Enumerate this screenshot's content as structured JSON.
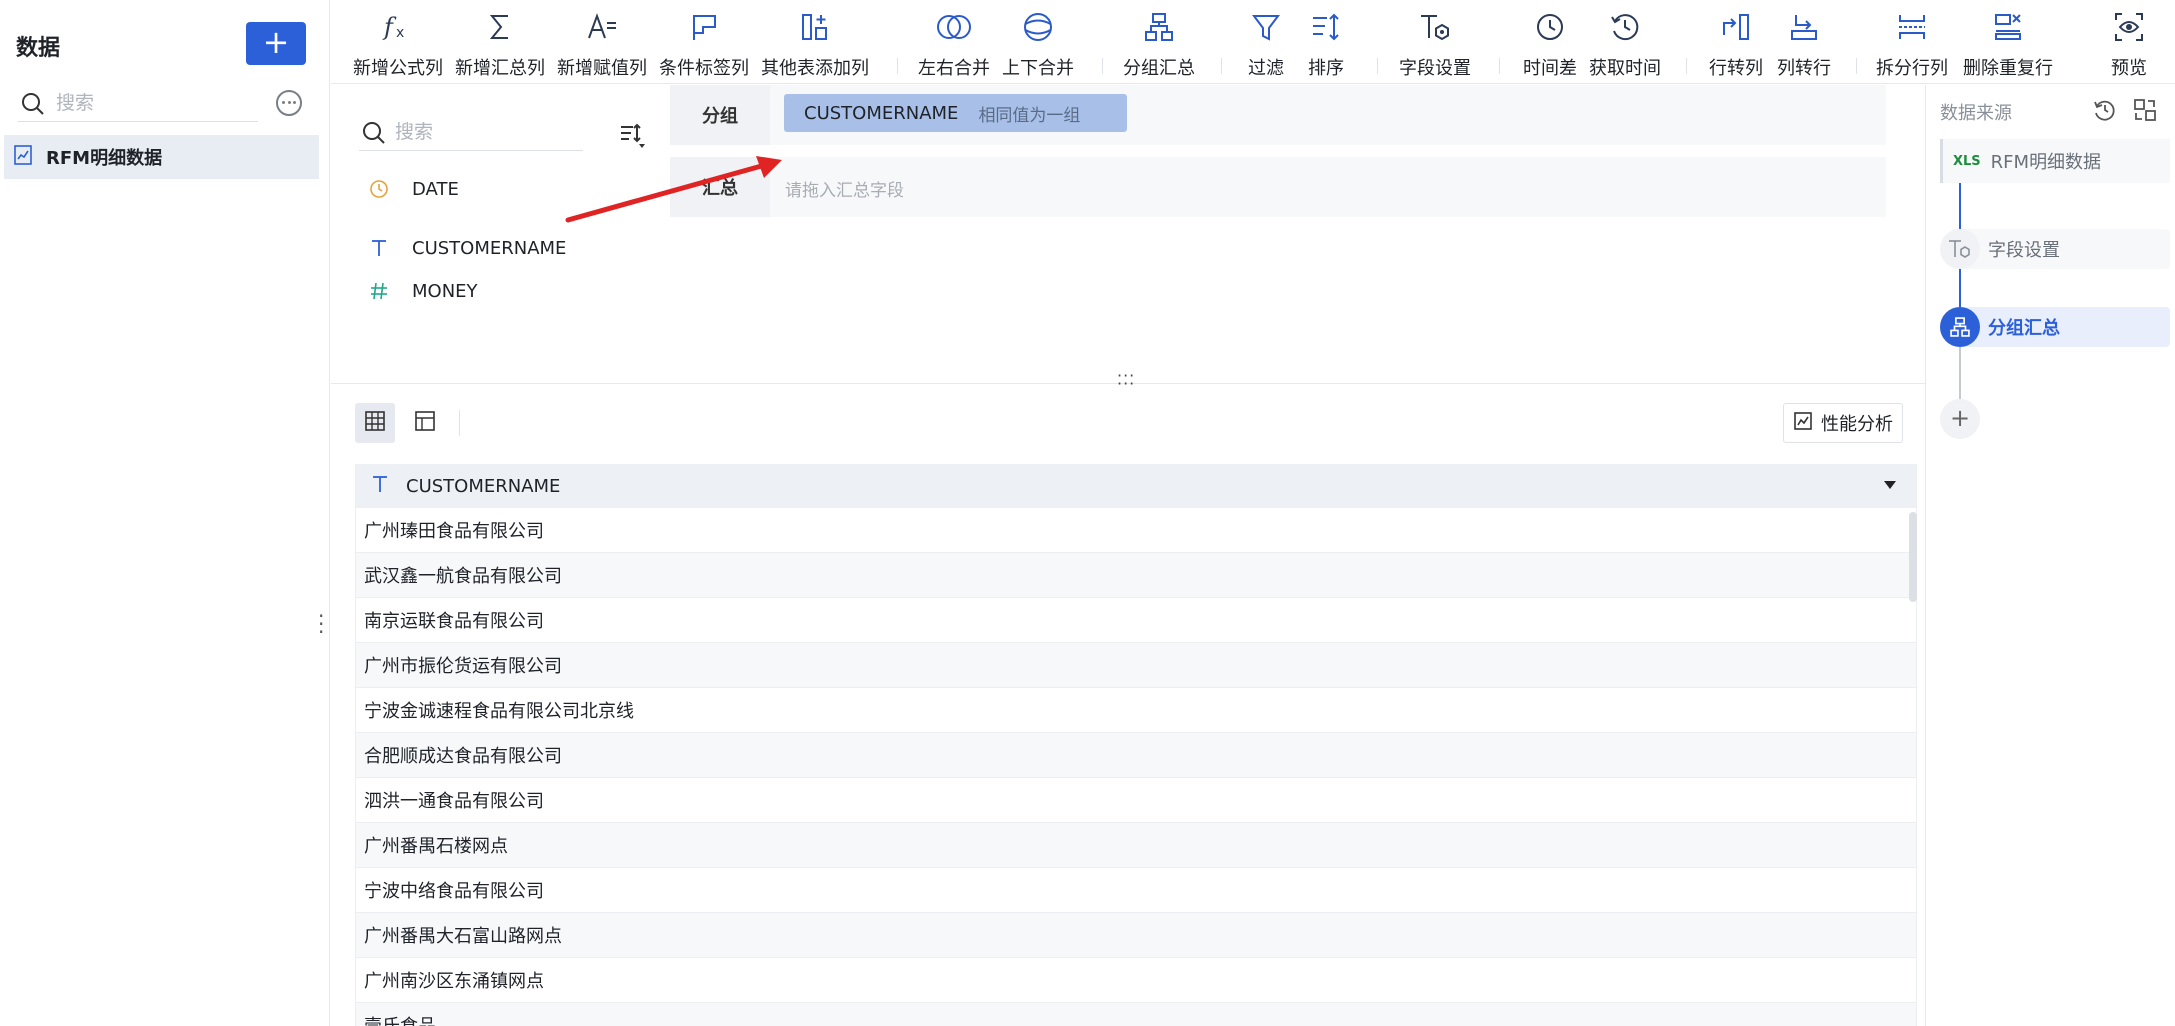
{
  "left": {
    "title": "数据",
    "add_label": "+",
    "search_placeholder": "搜索",
    "dataset": "RFM明细数据"
  },
  "toolbar": [
    {
      "id": "formula",
      "label": "新增公式列",
      "icon": "formula-fx-icon"
    },
    {
      "id": "summary",
      "label": "新增汇总列",
      "icon": "sigma-icon"
    },
    {
      "id": "assign",
      "label": "新增赋值列",
      "icon": "assign-value-icon"
    },
    {
      "id": "tag",
      "label": "条件标签列",
      "icon": "flag-icon"
    },
    {
      "id": "other",
      "label": "其他表添加列",
      "icon": "add-column-icon"
    },
    {
      "id": "lrmerge",
      "label": "左右合并",
      "icon": "left-right-merge-icon"
    },
    {
      "id": "udmerge",
      "label": "上下合并",
      "icon": "up-down-merge-icon"
    },
    {
      "id": "group",
      "label": "分组汇总",
      "icon": "group-summary-icon"
    },
    {
      "id": "filter",
      "label": "过滤",
      "icon": "filter-icon"
    },
    {
      "id": "sort",
      "label": "排序",
      "icon": "sort-icon"
    },
    {
      "id": "field",
      "label": "字段设置",
      "icon": "field-settings-icon"
    },
    {
      "id": "timediff",
      "label": "时间差",
      "icon": "clock-icon"
    },
    {
      "id": "gettime",
      "label": "获取时间",
      "icon": "clock-arrow-icon"
    },
    {
      "id": "rowtocol",
      "label": "行转列",
      "icon": "row-to-column-icon"
    },
    {
      "id": "coltorow",
      "label": "列转行",
      "icon": "column-to-row-icon"
    },
    {
      "id": "split",
      "label": "拆分行列",
      "icon": "split-icon"
    },
    {
      "id": "dedupe",
      "label": "删除重复行",
      "icon": "delete-duplicates-icon"
    },
    {
      "id": "preview",
      "label": "预览",
      "icon": "eye-icon"
    }
  ],
  "fields": {
    "search_placeholder": "搜索",
    "items": [
      {
        "name": "DATE",
        "type": "date",
        "icon": "clock-icon"
      },
      {
        "name": "CUSTOMERNAME",
        "type": "text",
        "icon": "text-T-icon"
      },
      {
        "name": "MONEY",
        "type": "number",
        "icon": "hash-icon"
      }
    ]
  },
  "group_zone": {
    "label": "分组",
    "chip_field": "CUSTOMERNAME",
    "chip_mode": "相同值为一组"
  },
  "summary_zone": {
    "label": "汇总",
    "placeholder": "请拖入汇总字段"
  },
  "preview": {
    "perf_label": "性能分析",
    "column": "CUSTOMERNAME",
    "rows": [
      "广州瑧田食品有限公司",
      "武汉鑫一航食品有限公司",
      "南京运联食品有限公司",
      "广州市振伦货运有限公司",
      "宁波金诚速程食品有限公司北京线",
      "合肥顺成达食品有限公司",
      "泗洪一通食品有限公司",
      "广州番禺石楼网点",
      "宁波中络食品有限公司",
      "广州番禺大石富山路网点",
      "广州南沙区东涌镇网点",
      "壹氏食品"
    ]
  },
  "right": {
    "title": "数据来源",
    "source": "RFM明细数据",
    "source_badge": "XLS",
    "steps": [
      "字段设置",
      "分组汇总"
    ]
  },
  "colors": {
    "accent": "#2c60d8",
    "chip": "#a8c0e8",
    "arrow": "#e02424"
  }
}
